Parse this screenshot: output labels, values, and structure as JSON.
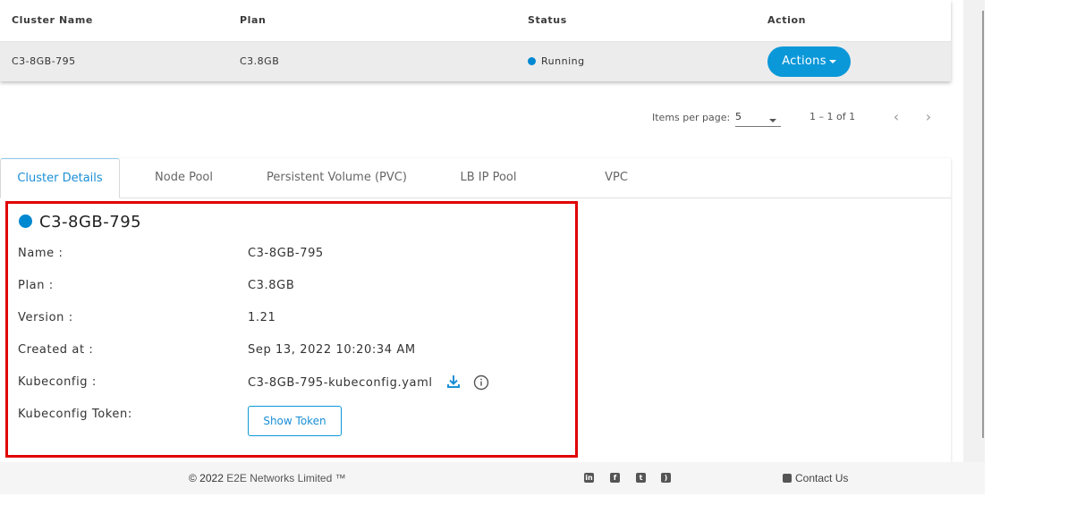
{
  "table": {
    "headers": {
      "name": "Cluster Name",
      "plan": "Plan",
      "status": "Status",
      "action": "Action"
    },
    "row": {
      "name": "C3-8GB-795",
      "plan": "C3.8GB",
      "status": "Running",
      "status_color": "#0088d1"
    },
    "actions_label": "Actions"
  },
  "paginator": {
    "items_per_page_label": "Items per page:",
    "items_per_page_value": "5",
    "range_label": "1 – 1 of 1"
  },
  "tabs": [
    {
      "label": "Cluster Details",
      "active": true
    },
    {
      "label": "Node Pool",
      "active": false
    },
    {
      "label": "Persistent Volume (PVC)",
      "active": false
    },
    {
      "label": "LB IP Pool",
      "active": false
    },
    {
      "label": "VPC",
      "active": false
    }
  ],
  "details": {
    "title": "C3-8GB-795",
    "rows": [
      {
        "label": "Name :",
        "value": "C3-8GB-795"
      },
      {
        "label": "Plan :",
        "value": "C3.8GB"
      },
      {
        "label": "Version :",
        "value": "1.21"
      },
      {
        "label": "Created at :",
        "value": "Sep 13, 2022 10:20:34 AM"
      },
      {
        "label": "Kubeconfig :",
        "value": "C3-8GB-795-kubeconfig.yaml"
      },
      {
        "label": "Kubeconfig Token:",
        "value": ""
      }
    ],
    "show_token_label": "Show Token"
  },
  "footer": {
    "copyright": "© 2022",
    "brand": "E2E Networks Limited ™",
    "social_icons": [
      "linkedin-icon",
      "facebook-icon",
      "twitter-icon",
      "rss-icon"
    ],
    "contact_label": "Contact Us"
  },
  "colors": {
    "accent": "#0b98d9",
    "highlight_border": "#e00000"
  }
}
